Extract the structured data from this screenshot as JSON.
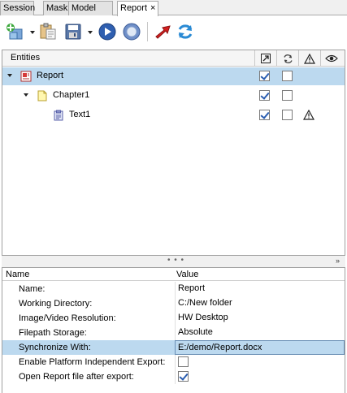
{
  "tabs": [
    {
      "label": "Session",
      "active": false
    },
    {
      "label": "Mask",
      "active": false
    },
    {
      "label": "Model",
      "active": false
    },
    {
      "label": "Report",
      "active": true,
      "close": "×"
    }
  ],
  "toolbar": {
    "buttons": [
      {
        "name": "add-entity-icon"
      },
      {
        "name": "paste-icon"
      },
      {
        "name": "save-icon"
      },
      {
        "name": "run-icon"
      },
      {
        "name": "stop-icon"
      },
      {
        "name": "export-icon"
      },
      {
        "name": "refresh-icon"
      }
    ]
  },
  "entities": {
    "header": "Entities",
    "header_icons": [
      "link-out-icon",
      "sync-icon",
      "warning-icon",
      "eye-icon"
    ],
    "rows": [
      {
        "label": "Report",
        "icon": "report-icon",
        "level": 0,
        "expanded": true,
        "selected": true,
        "export": true,
        "sync": false,
        "warning": false
      },
      {
        "label": "Chapter1",
        "icon": "folder-icon",
        "level": 1,
        "expanded": true,
        "selected": false,
        "export": true,
        "sync": false,
        "warning": false
      },
      {
        "label": "Text1",
        "icon": "text-item-icon",
        "level": 2,
        "expanded": false,
        "selected": false,
        "export": true,
        "sync": false,
        "warning": true
      }
    ]
  },
  "splitter": {
    "dots": "• • •",
    "chev": "»"
  },
  "properties": {
    "col_name": "Name",
    "col_value": "Value",
    "rows": [
      {
        "name": "Name:",
        "value": "Report"
      },
      {
        "name": "Working Directory:",
        "value": "C:/New folder"
      },
      {
        "name": "Image/Video Resolution:",
        "value": "HW Desktop"
      },
      {
        "name": "Filepath Storage:",
        "value": "Absolute"
      },
      {
        "name": "Synchronize With:",
        "value": "E:/demo/Report.docx",
        "selected": true
      },
      {
        "name": "Enable Platform Independent Export:",
        "checkbox": true,
        "checked": false
      },
      {
        "name": "Open Report file after export:",
        "checkbox": true,
        "checked": true
      }
    ]
  },
  "colors": {
    "selection": "#bcd9ef",
    "accent": "#2a5db0"
  }
}
